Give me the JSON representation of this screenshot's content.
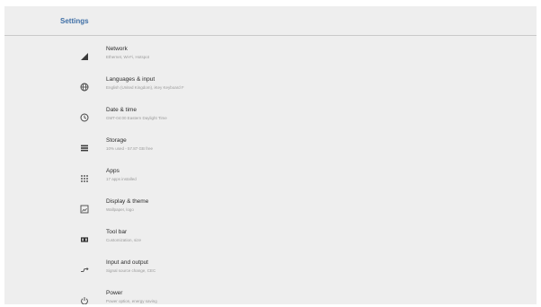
{
  "header": {
    "title": "Settings"
  },
  "items": [
    {
      "icon": "network-signal-icon",
      "label": "Network",
      "subtitle": "Ethernet, Wi-Fi, Hotspot"
    },
    {
      "icon": "globe-icon",
      "label": "Languages & input",
      "subtitle": "English (United Kingdom), iKey Keyboard F"
    },
    {
      "icon": "clock-icon",
      "label": "Date & time",
      "subtitle": "GMT-04:00 Eastern Daylight Time"
    },
    {
      "icon": "storage-icon",
      "label": "Storage",
      "subtitle": "10% used - 57.87 GB free"
    },
    {
      "icon": "apps-grid-icon",
      "label": "Apps",
      "subtitle": "17 apps installed"
    },
    {
      "icon": "display-theme-icon",
      "label": "Display & theme",
      "subtitle": "Wallpaper, logo"
    },
    {
      "icon": "tool-bar-icon",
      "label": "Tool bar",
      "subtitle": "Customization, size"
    },
    {
      "icon": "input-output-icon",
      "label": "Input and output",
      "subtitle": "Signal source change, CEC"
    },
    {
      "icon": "power-icon",
      "label": "Power",
      "subtitle": "Power option, energy saving"
    }
  ]
}
